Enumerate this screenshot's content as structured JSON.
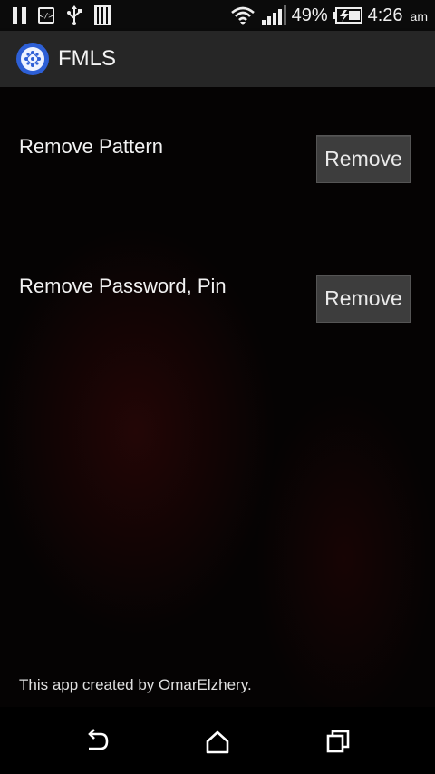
{
  "status_bar": {
    "battery_percent": "49%",
    "time": "4:26",
    "ampm": "am",
    "icons": [
      "pause-icon",
      "code-icon",
      "usb-icon",
      "sd-card-icon",
      "wifi-icon",
      "signal-icon",
      "battery-charging-icon"
    ]
  },
  "app_bar": {
    "title": "FMLS",
    "logo_icon": "app-logo-icon",
    "logo_color": "#2d5fd6"
  },
  "settings": [
    {
      "label": "Remove Pattern",
      "button_label": "Remove"
    },
    {
      "label": "Remove Password, Pin",
      "button_label": "Remove"
    }
  ],
  "footer": {
    "credit": "This app created by OmarElzhery."
  },
  "nav_bar": {
    "icons": [
      "back-icon",
      "home-icon",
      "recent-apps-icon"
    ]
  }
}
